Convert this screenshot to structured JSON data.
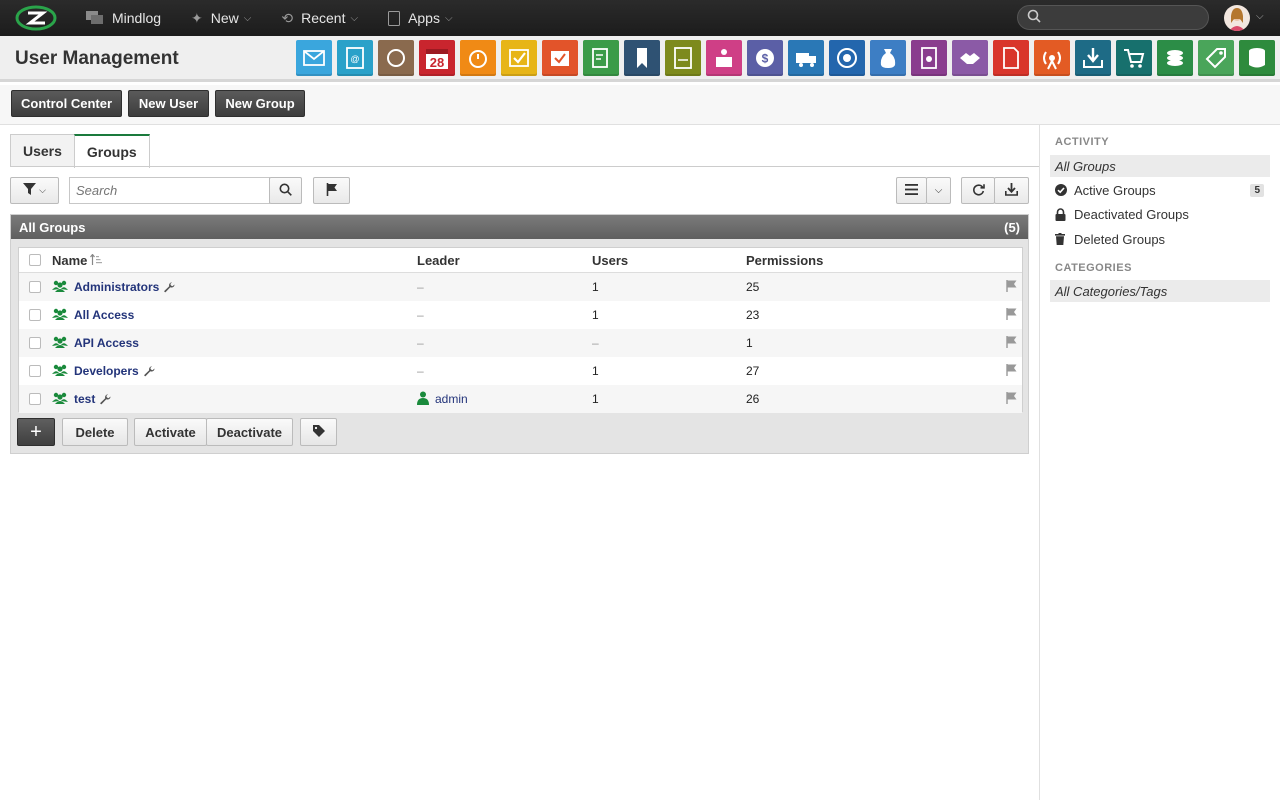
{
  "topbar": {
    "nav": [
      {
        "label": "Mindlog",
        "icon": "chat-icon"
      },
      {
        "label": "New",
        "icon": "sparkle-icon"
      },
      {
        "label": "Recent",
        "icon": "history-icon"
      },
      {
        "label": "Apps",
        "icon": "tablet-icon"
      }
    ],
    "search_placeholder": ""
  },
  "header": {
    "title": "User Management",
    "app_icons": [
      {
        "name": "mail-app-icon",
        "color": "#3aa6dd"
      },
      {
        "name": "address-book-app-icon",
        "color": "#2aa1c9"
      },
      {
        "name": "contacts-app-icon",
        "color": "#8a6a4e"
      },
      {
        "name": "calendar-app-icon",
        "color": "#c9252e",
        "text": "28"
      },
      {
        "name": "timer-app-icon",
        "color": "#f08a15"
      },
      {
        "name": "tasks-app-icon",
        "color": "#e7b517"
      },
      {
        "name": "projects-app-icon",
        "color": "#e2542a"
      },
      {
        "name": "notes-app-icon",
        "color": "#3b9b48"
      },
      {
        "name": "bookmarks-app-icon",
        "color": "#2f5273"
      },
      {
        "name": "documents-app-icon",
        "color": "#7d8a1d"
      },
      {
        "name": "storefront-app-icon",
        "color": "#cf3f86"
      },
      {
        "name": "billing-app-icon",
        "color": "#5b5fa6"
      },
      {
        "name": "shipping-app-icon",
        "color": "#2a78b6"
      },
      {
        "name": "support-app-icon",
        "color": "#2366ad"
      },
      {
        "name": "expenses-app-icon",
        "color": "#3d7ec4"
      },
      {
        "name": "contracts-app-icon",
        "color": "#8a3d8e"
      },
      {
        "name": "deals-app-icon",
        "color": "#8b5aa6"
      },
      {
        "name": "pdf-app-icon",
        "color": "#d9352b"
      },
      {
        "name": "broadcast-app-icon",
        "color": "#e35b24"
      },
      {
        "name": "downloads-app-icon",
        "color": "#1e6b86"
      },
      {
        "name": "shopping-app-icon",
        "color": "#17706d"
      },
      {
        "name": "payments-app-icon",
        "color": "#2c8d47"
      },
      {
        "name": "pricing-app-icon",
        "color": "#4aa55a"
      },
      {
        "name": "database-app-icon",
        "color": "#2e8b3d"
      }
    ]
  },
  "actions": {
    "control_center": "Control Center",
    "new_user": "New User",
    "new_group": "New Group"
  },
  "tabs": [
    "Users",
    "Groups"
  ],
  "search": {
    "placeholder": "Search"
  },
  "panel": {
    "title": "All Groups",
    "count": "(5)"
  },
  "grid": {
    "columns": {
      "name": "Name",
      "leader": "Leader",
      "users": "Users",
      "permissions": "Permissions"
    },
    "rows": [
      {
        "name": "Administrators",
        "wrench": true,
        "leader": "–",
        "users": "1",
        "permissions": "25"
      },
      {
        "name": "All Access",
        "wrench": false,
        "leader": "–",
        "users": "1",
        "permissions": "23"
      },
      {
        "name": "API Access",
        "wrench": false,
        "leader": "–",
        "users": "–",
        "permissions": "1"
      },
      {
        "name": "Developers",
        "wrench": true,
        "leader": "–",
        "users": "1",
        "permissions": "27"
      },
      {
        "name": "test",
        "wrench": true,
        "leader": "admin",
        "users": "1",
        "permissions": "26"
      }
    ]
  },
  "bottom": {
    "add": "+",
    "delete": "Delete",
    "activate": "Activate",
    "deactivate": "Deactivate"
  },
  "sidebar": {
    "activity_label": "ACTIVITY",
    "activity": [
      {
        "label": "All Groups",
        "selected": true
      },
      {
        "label": "Active Groups",
        "badge": "5"
      },
      {
        "label": "Deactivated Groups"
      },
      {
        "label": "Deleted Groups"
      }
    ],
    "categories_label": "CATEGORIES",
    "categories": [
      {
        "label": "All Categories/Tags",
        "selected": true
      }
    ]
  }
}
